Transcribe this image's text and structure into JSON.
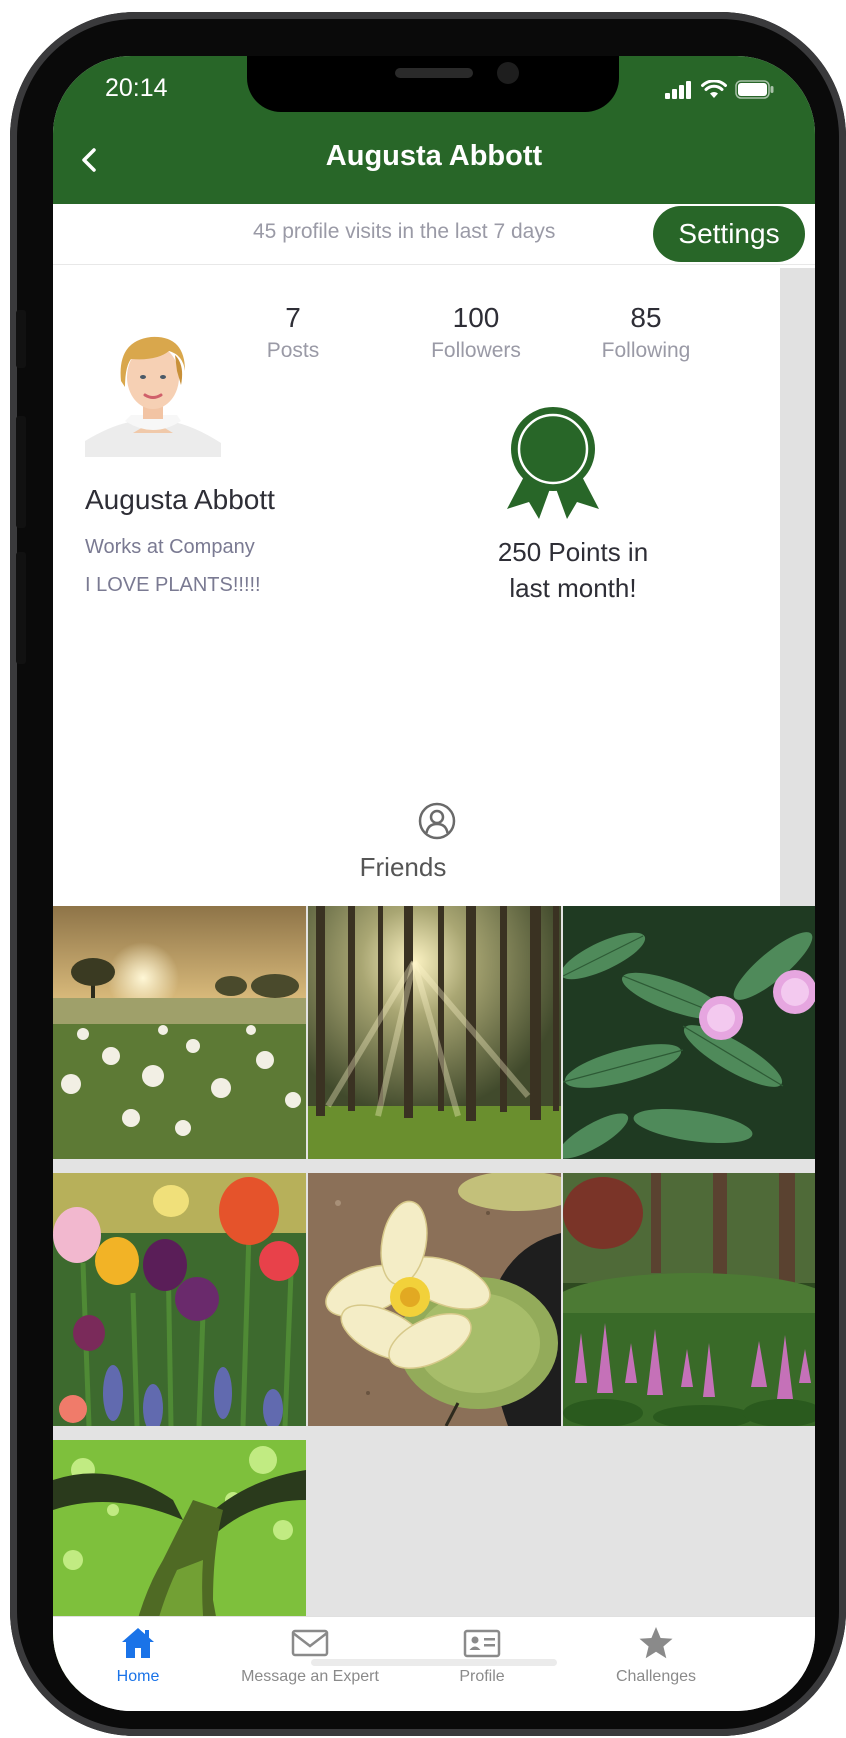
{
  "status_bar": {
    "time": "20:14"
  },
  "header": {
    "title": "Augusta Abbott"
  },
  "visits_text": "45 profile visits in the last 7 days",
  "settings_label": "Settings",
  "stats": [
    {
      "value": "7",
      "label": "Posts"
    },
    {
      "value": "100",
      "label": "Followers"
    },
    {
      "value": "85",
      "label": "Following"
    }
  ],
  "points": {
    "line1": "250 Points in",
    "line2": "last month!"
  },
  "profile": {
    "name": "Augusta Abbott",
    "work": "Works at Company",
    "bio": "I LOVE PLANTS!!!!!"
  },
  "friends_label": "Friends",
  "tabs": [
    {
      "label": "Home",
      "icon": "home-icon",
      "active": true
    },
    {
      "label": "Message an Expert",
      "icon": "envelope-icon",
      "active": false
    },
    {
      "label": "Profile",
      "icon": "id-card-icon",
      "active": false
    },
    {
      "label": "Challenges",
      "icon": "star-icon",
      "active": false
    }
  ],
  "colors": {
    "header_green": "#286628",
    "active_tab_blue": "#1a73e8",
    "inactive_gray": "#8a8a8a"
  }
}
